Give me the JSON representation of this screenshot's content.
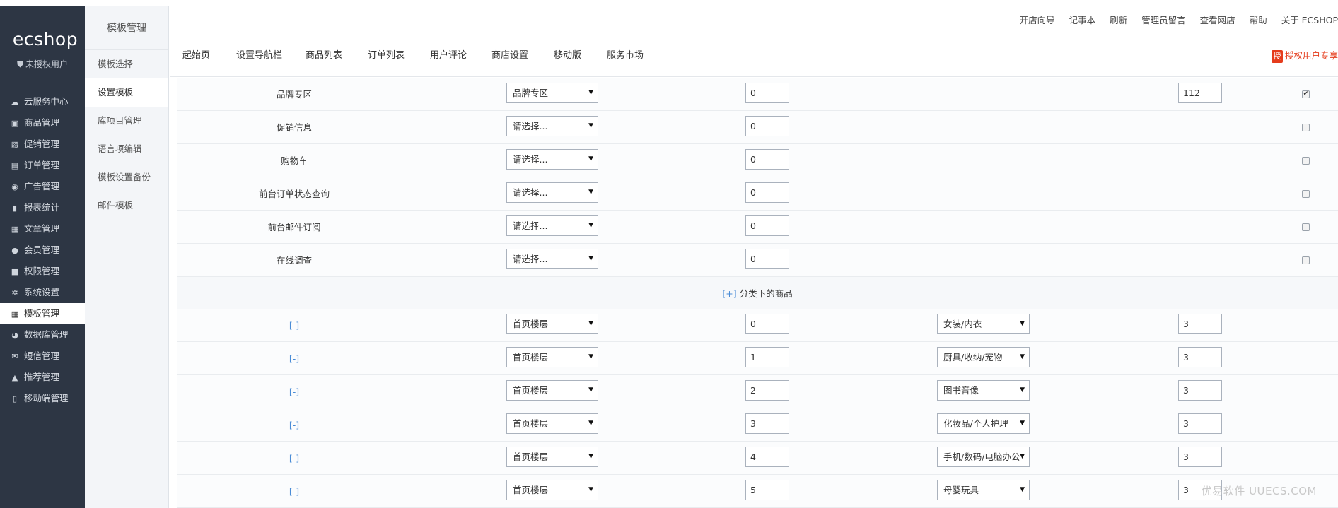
{
  "brand": {
    "logo": "ecshop",
    "user_status": "未授权用户"
  },
  "sidebar": {
    "items": [
      {
        "icon": "cloud-icon",
        "glyph": "☁",
        "label": "云服务中心"
      },
      {
        "icon": "goods-icon",
        "glyph": "▣",
        "label": "商品管理"
      },
      {
        "icon": "promo-icon",
        "glyph": "▨",
        "label": "促销管理"
      },
      {
        "icon": "order-icon",
        "glyph": "▤",
        "label": "订单管理"
      },
      {
        "icon": "ad-icon",
        "glyph": "◉",
        "label": "广告管理"
      },
      {
        "icon": "chart-icon",
        "glyph": "▮",
        "label": "报表统计"
      },
      {
        "icon": "article-icon",
        "glyph": "▦",
        "label": "文章管理"
      },
      {
        "icon": "user-icon",
        "glyph": "●",
        "label": "会员管理"
      },
      {
        "icon": "lock-icon",
        "glyph": "■",
        "label": "权限管理"
      },
      {
        "icon": "gear-icon",
        "glyph": "✲",
        "label": "系统设置"
      },
      {
        "icon": "template-icon",
        "glyph": "▦",
        "label": "模板管理",
        "active": true
      },
      {
        "icon": "database-icon",
        "glyph": "◕",
        "label": "数据库管理"
      },
      {
        "icon": "mail-icon",
        "glyph": "✉",
        "label": "短信管理"
      },
      {
        "icon": "thumb-icon",
        "glyph": "▲",
        "label": "推荐管理"
      },
      {
        "icon": "mobile-icon",
        "glyph": "▯",
        "label": "移动端管理"
      }
    ]
  },
  "subnav": {
    "title": "模板管理",
    "items": [
      "模板选择",
      "设置模板",
      "库项目管理",
      "语言项编辑",
      "模板设置备份",
      "邮件模板"
    ],
    "active_index": 1
  },
  "utilbar": {
    "links": [
      "开店向导",
      "记事本",
      "刷新",
      "管理员留言",
      "查看网店",
      "帮助",
      "关于 ECSHOP"
    ]
  },
  "mainnav": {
    "items": [
      "起始页",
      "设置导航栏",
      "商品列表",
      "订单列表",
      "用户评论",
      "商店设置",
      "移动版",
      "服务市场"
    ],
    "auth_badge_glyph": "授",
    "auth_label": "授权用户专享"
  },
  "rows_top": [
    {
      "name": "品牌专区",
      "region": "品牌专区",
      "order": "0",
      "number": "112",
      "checked": true
    },
    {
      "name": "促销信息",
      "region": "请选择...",
      "order": "0",
      "number": "",
      "checked": false
    },
    {
      "name": "购物车",
      "region": "请选择...",
      "order": "0",
      "number": "",
      "checked": false
    },
    {
      "name": "前台订单状态查询",
      "region": "请选择...",
      "order": "0",
      "number": "",
      "checked": false
    },
    {
      "name": "前台邮件订阅",
      "region": "请选择...",
      "order": "0",
      "number": "",
      "checked": false
    },
    {
      "name": "在线调查",
      "region": "请选择...",
      "order": "0",
      "number": "",
      "checked": false
    }
  ],
  "category_section": {
    "toggle": "[+]",
    "title": "分类下的商品"
  },
  "category_rows": [
    {
      "toggle": "[-]",
      "region": "首页楼层",
      "order": "0",
      "category": "女装/内衣",
      "number": "3"
    },
    {
      "toggle": "[-]",
      "region": "首页楼层",
      "order": "1",
      "category": "厨具/收纳/宠物",
      "number": "3"
    },
    {
      "toggle": "[-]",
      "region": "首页楼层",
      "order": "2",
      "category": "图书音像",
      "number": "3"
    },
    {
      "toggle": "[-]",
      "region": "首页楼层",
      "order": "3",
      "category": "化妆品/个人护理",
      "number": "3"
    },
    {
      "toggle": "[-]",
      "region": "首页楼层",
      "order": "4",
      "category": "手机/数码/电脑办公",
      "number": "3"
    },
    {
      "toggle": "[-]",
      "region": "首页楼层",
      "order": "5",
      "category": "母婴玩具",
      "number": "3"
    }
  ],
  "watermark": "优易软件 UUECS.COM",
  "dropdown_arrow": "▼",
  "check_mark": "✔"
}
